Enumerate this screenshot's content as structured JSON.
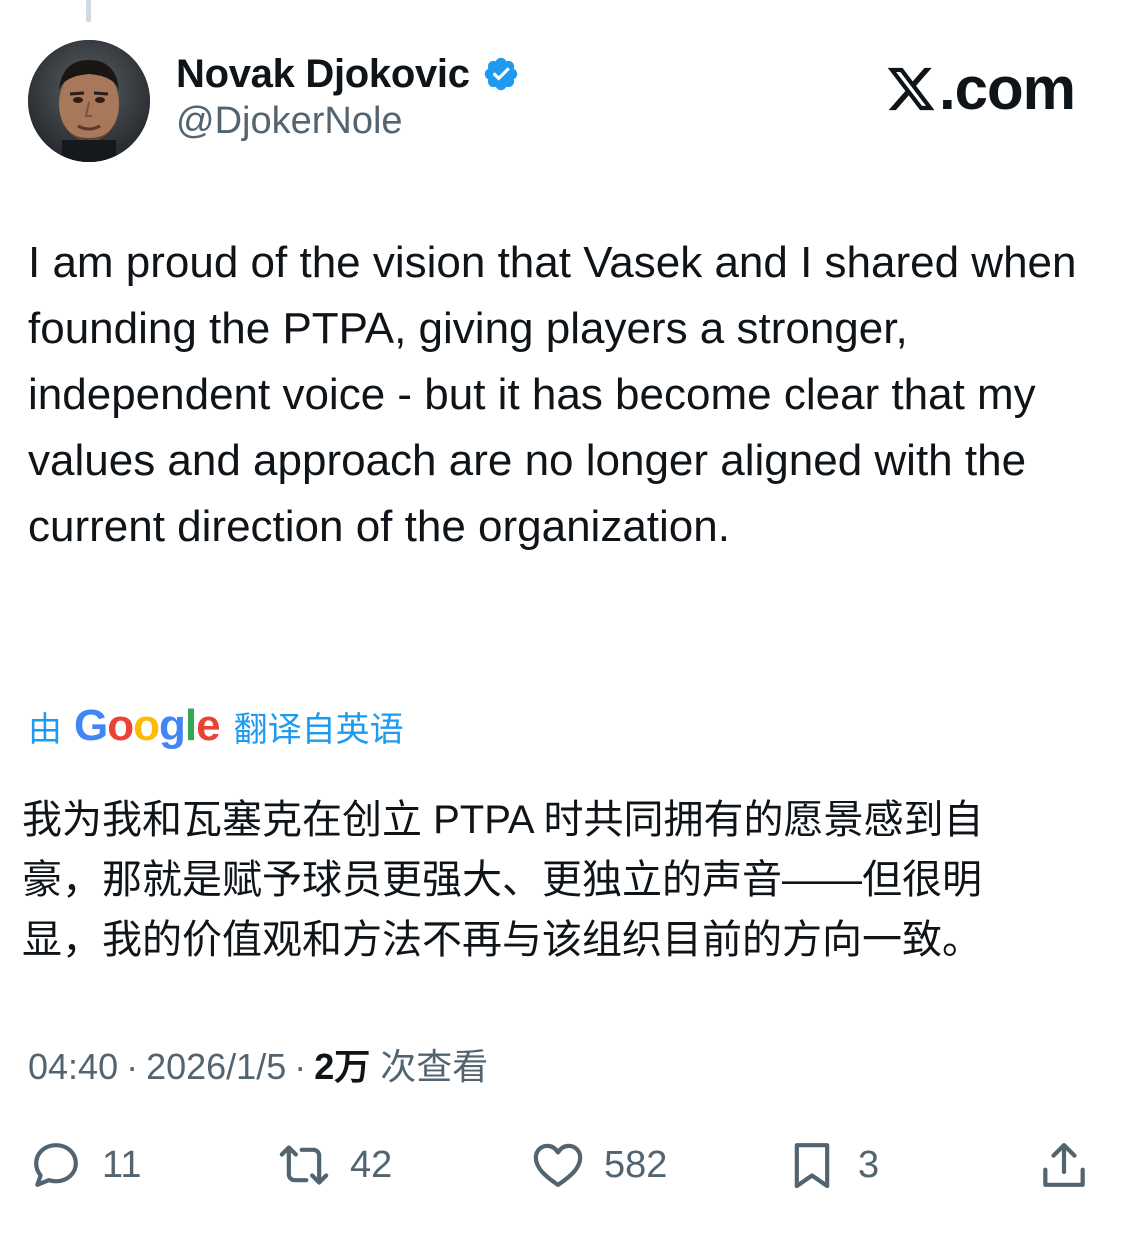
{
  "author": {
    "name": "Novak Djokovic",
    "handle": "@DjokerNole",
    "verified": true
  },
  "brand": {
    "label": ".com",
    "icon": "x-logo-icon"
  },
  "post": {
    "text": "I am proud of the vision that Vasek and I shared when founding the PTPA, giving players a stronger, independent voice - but it has become clear that my values and approach are no longer aligned with the current direction of the organization."
  },
  "translation": {
    "prefix": "由",
    "provider": "Google",
    "suffix": "翻译自英语",
    "text": "我为我和瓦塞克在创立 PTPA 时共同拥有的愿景感到自豪，那就是赋予球员更强大、更独立的声音——但很明显，我的价值观和方法不再与该组织目前的方向一致。"
  },
  "meta": {
    "time": "04:40",
    "separator": "·",
    "date": "2026/1/5",
    "views_count": "2万",
    "views_label": "次查看"
  },
  "actions": {
    "replies": "11",
    "reposts": "42",
    "likes": "582",
    "bookmarks": "3"
  },
  "colors": {
    "accent": "#1d9bf0",
    "text": "#0f1419",
    "muted": "#536471"
  }
}
